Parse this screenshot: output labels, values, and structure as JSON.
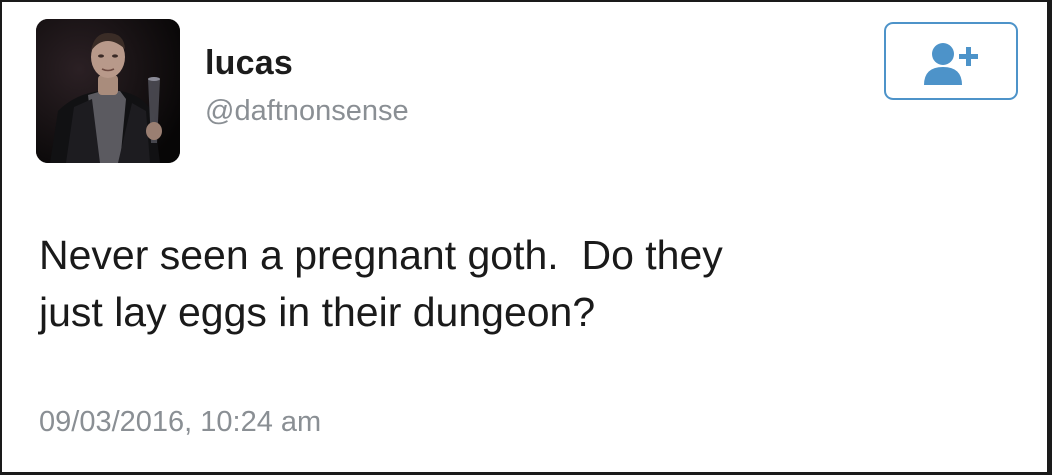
{
  "user": {
    "display_name": "lucas",
    "handle": "@daftnonsense"
  },
  "follow_button": {
    "icon": "add-user-icon",
    "color": "#4d93c9"
  },
  "tweet": {
    "text": "Never seen a pregnant goth.  Do they\njust lay eggs in their dungeon?",
    "timestamp": "09/03/2016, 10:24 am"
  }
}
